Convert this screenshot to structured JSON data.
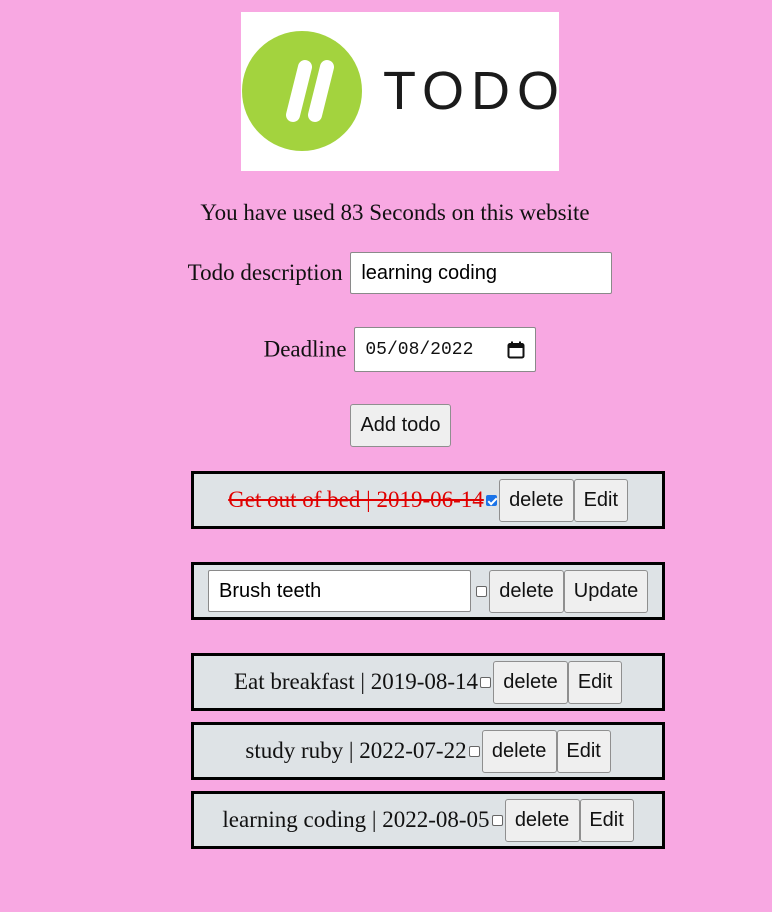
{
  "logo": {
    "text": "TODO",
    "mark": "//",
    "brand_color": "#a3d33e"
  },
  "timer": {
    "text": "You have used 83 Seconds on this website"
  },
  "form": {
    "description_label": "Todo description",
    "description_value": "learning coding",
    "deadline_label": "Deadline",
    "deadline_value": "05/08/2022",
    "add_label": "Add todo"
  },
  "todos": [
    {
      "text": "Get out of bed | 2019-06-14",
      "done": true,
      "delete_label": "delete",
      "edit_label": "Edit"
    },
    {
      "edit_value": "Brush teeth",
      "editing": true,
      "done": false,
      "delete_label": "delete",
      "update_label": "Update"
    },
    {
      "text": "Eat breakfast | 2019-08-14",
      "done": false,
      "delete_label": "delete",
      "edit_label": "Edit"
    },
    {
      "text": "study ruby | 2022-07-22",
      "done": false,
      "delete_label": "delete",
      "edit_label": "Edit"
    },
    {
      "text": "learning coding | 2022-08-05",
      "done": false,
      "delete_label": "delete",
      "edit_label": "Edit"
    }
  ],
  "colors": {
    "background": "#f8a8e2",
    "todo_bg": "#dee3e6",
    "done_text": "#e00000",
    "checkbox_checked": "#1a73e8"
  }
}
